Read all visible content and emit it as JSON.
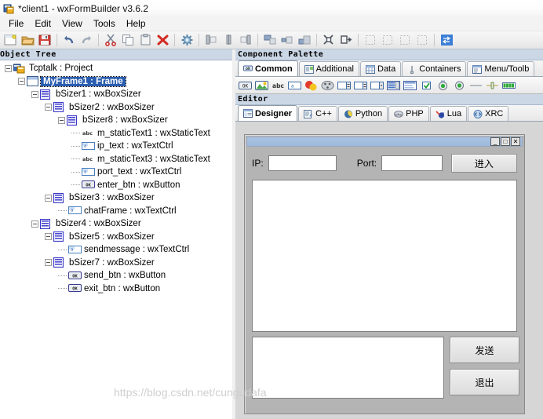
{
  "window": {
    "title": "*client1 - wxFormBuilder v3.6.2",
    "app_icon": "wxformbuilder-icon"
  },
  "menubar": {
    "items": [
      {
        "label": "File"
      },
      {
        "label": "Edit"
      },
      {
        "label": "View"
      },
      {
        "label": "Tools"
      },
      {
        "label": "Help"
      }
    ]
  },
  "toolbar": {
    "buttons": [
      {
        "name": "new-project-icon",
        "tooltip": "New"
      },
      {
        "name": "open-project-icon",
        "tooltip": "Open"
      },
      {
        "name": "save-project-icon",
        "tooltip": "Save"
      },
      {
        "name": "undo-icon",
        "tooltip": "Undo"
      },
      {
        "name": "redo-icon",
        "tooltip": "Redo"
      },
      {
        "name": "cut-icon",
        "tooltip": "Cut"
      },
      {
        "name": "copy-icon",
        "tooltip": "Copy"
      },
      {
        "name": "paste-icon",
        "tooltip": "Paste"
      },
      {
        "name": "delete-icon",
        "tooltip": "Delete"
      },
      {
        "name": "generate-code-icon",
        "tooltip": "Generate Code"
      },
      {
        "name": "align-left-icon",
        "tooltip": "Align Left"
      },
      {
        "name": "align-center-icon",
        "tooltip": "Align Center"
      },
      {
        "name": "align-right-icon",
        "tooltip": "Align Right"
      },
      {
        "name": "align-top-icon",
        "tooltip": "Align Top"
      },
      {
        "name": "align-middle-icon",
        "tooltip": "Align Middle"
      },
      {
        "name": "align-bottom-icon",
        "tooltip": "Align Bottom"
      },
      {
        "name": "expand-icon",
        "tooltip": "Expand"
      },
      {
        "name": "stretch-icon",
        "tooltip": "Stretch"
      },
      {
        "name": "border-left-icon",
        "tooltip": "Border Left"
      },
      {
        "name": "border-right-icon",
        "tooltip": "Border Right"
      },
      {
        "name": "border-top-icon",
        "tooltip": "Border Top"
      },
      {
        "name": "border-bottom-icon",
        "tooltip": "Border Bottom"
      },
      {
        "name": "toggle-orientation-icon",
        "tooltip": "Toggle Orientation"
      }
    ]
  },
  "object_tree": {
    "caption": "Object Tree",
    "selected": "MyFrame1 : Frame",
    "nodes": [
      {
        "label": "Tcptalk : Project",
        "depth": 0,
        "icon": "project-icon",
        "expander": true
      },
      {
        "label": "MyFrame1 : Frame",
        "depth": 1,
        "icon": "frame-icon",
        "expander": true,
        "selected": true
      },
      {
        "label": "bSizer1 : wxBoxSizer",
        "depth": 2,
        "icon": "sizer-icon",
        "expander": true
      },
      {
        "label": "bSizer2 : wxBoxSizer",
        "depth": 3,
        "icon": "sizer-icon",
        "expander": true
      },
      {
        "label": "bSizer8 : wxBoxSizer",
        "depth": 4,
        "icon": "sizer-icon",
        "expander": true
      },
      {
        "label": "m_staticText1 : wxStaticText",
        "depth": 5,
        "icon": "statictext-icon",
        "expander": false
      },
      {
        "label": "ip_text : wxTextCtrl",
        "depth": 5,
        "icon": "textctrl-icon",
        "expander": false
      },
      {
        "label": "m_staticText3 : wxStaticText",
        "depth": 5,
        "icon": "statictext-icon",
        "expander": false
      },
      {
        "label": "port_text : wxTextCtrl",
        "depth": 5,
        "icon": "textctrl-icon",
        "expander": false
      },
      {
        "label": "enter_btn : wxButton",
        "depth": 5,
        "icon": "button-icon",
        "expander": false
      },
      {
        "label": "bSizer3 : wxBoxSizer",
        "depth": 3,
        "icon": "sizer-icon",
        "expander": true
      },
      {
        "label": "chatFrame : wxTextCtrl",
        "depth": 4,
        "icon": "textctrl-icon",
        "expander": false
      },
      {
        "label": "bSizer4 : wxBoxSizer",
        "depth": 2,
        "icon": "sizer-icon",
        "expander": true
      },
      {
        "label": "bSizer5 : wxBoxSizer",
        "depth": 3,
        "icon": "sizer-icon",
        "expander": true
      },
      {
        "label": "sendmessage : wxTextCtrl",
        "depth": 4,
        "icon": "textctrl-icon",
        "expander": false
      },
      {
        "label": "bSizer7 : wxBoxSizer",
        "depth": 3,
        "icon": "sizer-icon",
        "expander": true
      },
      {
        "label": "send_btn : wxButton",
        "depth": 4,
        "icon": "button-icon",
        "expander": false
      },
      {
        "label": "exit_btn : wxButton",
        "depth": 4,
        "icon": "button-icon",
        "expander": false
      }
    ]
  },
  "component_palette": {
    "caption": "Component Palette",
    "tabs": [
      {
        "label": "Common",
        "icon": "common-icon",
        "active": true
      },
      {
        "label": "Additional",
        "icon": "additional-icon",
        "active": false
      },
      {
        "label": "Data",
        "icon": "data-icon",
        "active": false
      },
      {
        "label": "Containers",
        "icon": "containers-icon",
        "active": false
      },
      {
        "label": "Menu/Toolb",
        "icon": "menu-toolbar-icon",
        "active": false
      }
    ],
    "items": [
      {
        "name": "wxbutton-icon"
      },
      {
        "name": "wxbitmapbutton-icon"
      },
      {
        "name": "wxstatictext-icon"
      },
      {
        "name": "wxtextctrl-icon"
      },
      {
        "name": "wxstaticbitmap-icon"
      },
      {
        "name": "wxcombobox-icon"
      },
      {
        "name": "wxspinctrl-icon"
      },
      {
        "name": "wxspinbutton-icon"
      },
      {
        "name": "wxchoice-icon"
      },
      {
        "name": "wxlistbox-icon"
      },
      {
        "name": "wxlistctrl-icon"
      },
      {
        "name": "wxcheckbox-icon"
      },
      {
        "name": "wxradiobutton-icon"
      },
      {
        "name": "wxtogglebutton-icon"
      },
      {
        "name": "wxstaticline-icon"
      },
      {
        "name": "wxslider-icon"
      },
      {
        "name": "wxgauge-icon"
      }
    ]
  },
  "editor": {
    "caption": "Editor",
    "tabs": [
      {
        "label": "Designer",
        "icon": "designer-icon",
        "active": true
      },
      {
        "label": "C++",
        "icon": "cpp-icon",
        "active": false
      },
      {
        "label": "Python",
        "icon": "python-icon",
        "active": false
      },
      {
        "label": "PHP",
        "icon": "php-icon",
        "active": false
      },
      {
        "label": "Lua",
        "icon": "lua-icon",
        "active": false
      },
      {
        "label": "XRC",
        "icon": "xrc-icon",
        "active": false
      }
    ]
  },
  "designer": {
    "form": {
      "title": "",
      "window_buttons": [
        {
          "name": "minimize-button",
          "glyph": "_"
        },
        {
          "name": "maximize-button",
          "glyph": "□"
        },
        {
          "name": "close-button",
          "glyph": "✕"
        }
      ],
      "ip_label": "IP:",
      "ip_value": "",
      "port_label": "Port:",
      "port_value": "",
      "enter_button": "进入",
      "chat_value": "",
      "send_message_value": "",
      "send_button": "发送",
      "exit_button": "退出"
    }
  },
  "watermark": "https://blog.csdn.net/cungudafa"
}
